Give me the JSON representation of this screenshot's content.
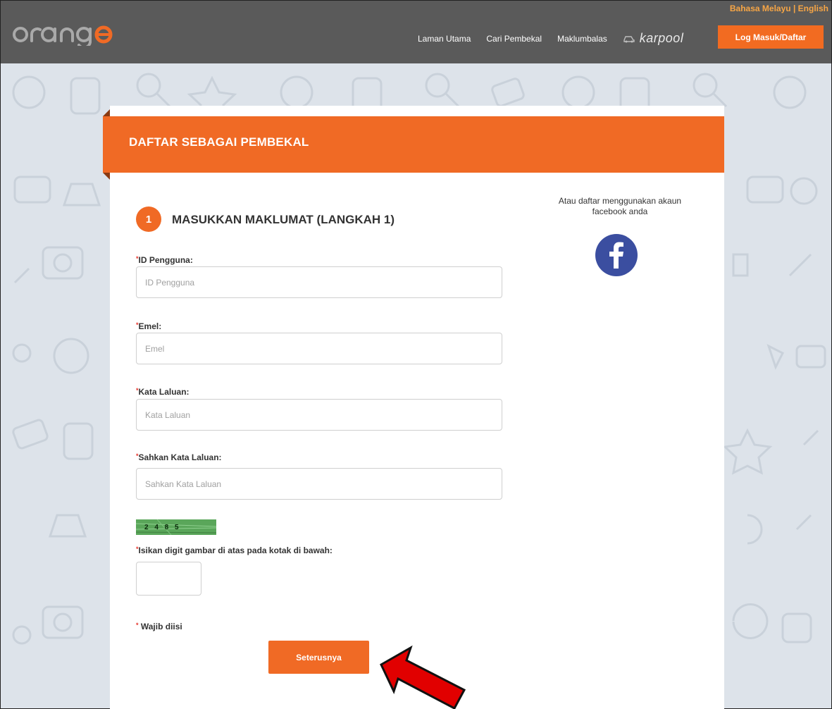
{
  "header": {
    "logo_text": "orange",
    "lang_malay": "Bahasa Melayu",
    "lang_separator": "|",
    "lang_english": "English",
    "nav": [
      "Laman Utama",
      "Cari Pembekal",
      "Maklumbalas"
    ],
    "karpool": "karpool",
    "login_label": "Log Masuk/Daftar"
  },
  "form": {
    "banner_title": "DAFTAR SEBAGAI PEMBEKAL",
    "step_number": "1",
    "step_title": "MASUKKAN MAKLUMAT (LANGKAH 1)",
    "fields": [
      {
        "label": "ID Pengguna:",
        "placeholder": "ID Pengguna",
        "value": ""
      },
      {
        "label": "Emel:",
        "placeholder": "Emel",
        "value": ""
      },
      {
        "label": "Kata Laluan:",
        "placeholder": "Kata Laluan",
        "value": ""
      },
      {
        "label": "Sahkan Kata Laluan:",
        "placeholder": "Sahkan Kata Laluan",
        "value": ""
      }
    ],
    "required_mark": "*",
    "captcha_digits": "2  4 8 5",
    "captcha_label": "Isikan digit gambar di atas pada kotak di bawah:",
    "required_note": "Wajib diisi",
    "next_label": "Seterusnya",
    "facebook_text": "Atau daftar menggunakan akaun facebook anda",
    "facebook_glyph": "f"
  },
  "colors": {
    "accent": "#f06a25",
    "header_bg": "#5a5a5a",
    "facebook": "#3b4ea0",
    "arrow": "#e10000"
  },
  "icons": [
    "facebook-icon",
    "car-icon",
    "annotation-arrow-icon"
  ]
}
